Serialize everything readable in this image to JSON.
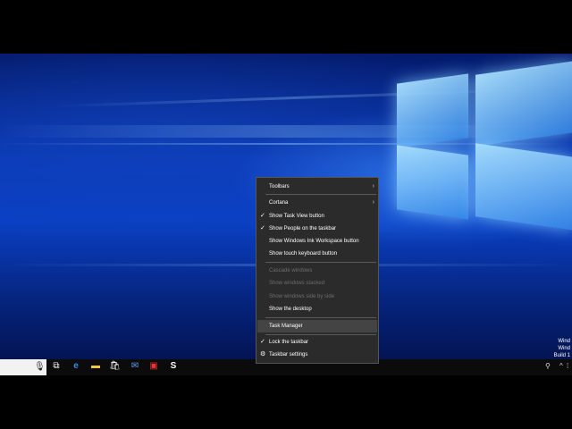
{
  "context_menu": {
    "items": [
      {
        "label": "Toolbars",
        "checked": false,
        "submenu": true,
        "enabled": true
      },
      {
        "label": "Cortana",
        "checked": false,
        "submenu": true,
        "enabled": true
      },
      {
        "label": "Show Task View button",
        "checked": true,
        "submenu": false,
        "enabled": true
      },
      {
        "label": "Show People on the taskbar",
        "checked": true,
        "submenu": false,
        "enabled": true
      },
      {
        "label": "Show Windows Ink Workspace button",
        "checked": false,
        "submenu": false,
        "enabled": true
      },
      {
        "label": "Show touch keyboard button",
        "checked": false,
        "submenu": false,
        "enabled": true
      },
      {
        "label": "Cascade windows",
        "checked": false,
        "submenu": false,
        "enabled": false
      },
      {
        "label": "Show windows stacked",
        "checked": false,
        "submenu": false,
        "enabled": false
      },
      {
        "label": "Show windows side by side",
        "checked": false,
        "submenu": false,
        "enabled": false
      },
      {
        "label": "Show the desktop",
        "checked": false,
        "submenu": false,
        "enabled": true
      },
      {
        "label": "Task Manager",
        "checked": false,
        "submenu": false,
        "enabled": true,
        "hovered": true
      },
      {
        "label": "Lock the taskbar",
        "checked": true,
        "submenu": false,
        "enabled": true
      },
      {
        "label": "Taskbar settings",
        "checked": false,
        "submenu": false,
        "enabled": true,
        "icon": "gear-icon"
      }
    ],
    "check_glyph": "✓",
    "arrow_glyph": "›",
    "gear_glyph": "⚙"
  },
  "watermark": {
    "line1": "Wind",
    "line2": "Wind",
    "line3": "Build 1"
  },
  "taskbar": {
    "icons": [
      {
        "name": "microphone-icon",
        "glyph": "🎙"
      },
      {
        "name": "task-view-icon",
        "glyph": "⧉"
      },
      {
        "name": "edge-browser-icon",
        "glyph": "e"
      },
      {
        "name": "file-explorer-icon",
        "glyph": "▬"
      },
      {
        "name": "store-icon",
        "glyph": "🛍"
      },
      {
        "name": "mail-icon",
        "glyph": "✉"
      },
      {
        "name": "app-icon",
        "glyph": "▣"
      },
      {
        "name": "snagit-icon",
        "glyph": "S"
      }
    ],
    "tray": {
      "people_glyph": "⚲",
      "chevron_glyph": "^",
      "more_glyph": "⁞"
    }
  },
  "colors": {
    "menu_bg": "#2b2b2b",
    "menu_hover": "#444444",
    "desktop_accent": "#0a40c4",
    "taskbar_bg": "#0b0b0b"
  }
}
